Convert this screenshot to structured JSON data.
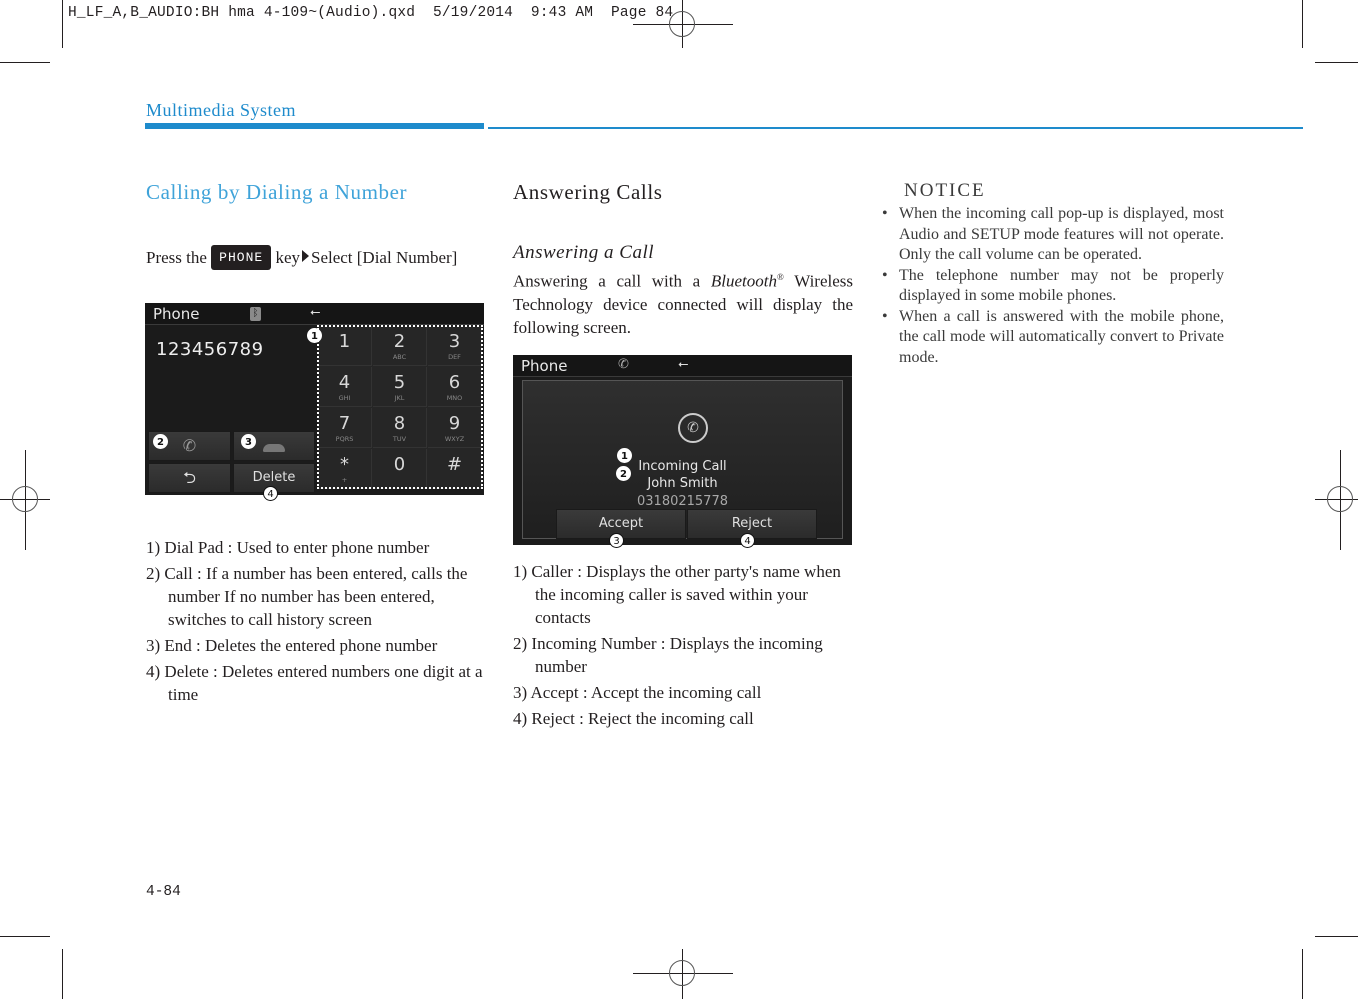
{
  "slug": "H_LF_A,B_AUDIO:BH hma 4-109~(Audio).qxd  5/19/2014  9:43 AM  Page 84",
  "header": {
    "section_title": "Multimedia System"
  },
  "colors": {
    "accent": "#1e8bcc",
    "heading_blue": "#3fa3d9",
    "text": "#231f20"
  },
  "column1": {
    "heading": "Calling by Dialing a Number",
    "instruction": {
      "prefix": "Press the",
      "key_label": "PHONE",
      "middle": "key",
      "suffix": "Select [Dial Number]"
    },
    "screen": {
      "title": "Phone",
      "status_icons": [
        "bluetooth-icon",
        "usb-icon"
      ],
      "entered_number": "123456789",
      "keys": [
        {
          "digit": "1",
          "letters": ""
        },
        {
          "digit": "2",
          "letters": "ABC"
        },
        {
          "digit": "3",
          "letters": "DEF"
        },
        {
          "digit": "4",
          "letters": "GHI"
        },
        {
          "digit": "5",
          "letters": "JKL"
        },
        {
          "digit": "6",
          "letters": "MNO"
        },
        {
          "digit": "7",
          "letters": "PQRS"
        },
        {
          "digit": "8",
          "letters": "TUV"
        },
        {
          "digit": "9",
          "letters": "WXYZ"
        },
        {
          "digit": "*",
          "letters": "+"
        },
        {
          "digit": "0",
          "letters": ""
        },
        {
          "digit": "#",
          "letters": ""
        }
      ],
      "buttons": {
        "call_icon": "call-icon",
        "end_icon": "end-call-icon",
        "back_icon": "back-icon",
        "delete": "Delete"
      },
      "callouts": [
        "1",
        "2",
        "3",
        "4"
      ]
    },
    "items": [
      "1) Dial Pad : Used to enter phone number",
      "2) Call : If a number has been entered, calls the number If no number has been entered, switches to call history screen",
      "3) End : Deletes the entered phone number",
      "4) Delete : Deletes entered numbers one digit at a time"
    ]
  },
  "column2": {
    "heading": "Answering Calls",
    "subheading": "Answering a Call",
    "intro_prefix": "Answering a call with a ",
    "intro_brand": "Bluetooth",
    "intro_reg": "®",
    "intro_suffix": " Wireless Technology device connected will display the following screen.",
    "screen": {
      "title": "Phone",
      "status_icons": [
        "call-icon",
        "usb-icon"
      ],
      "label": "Incoming Call",
      "caller": "John Smith",
      "number": "03180215778",
      "accept": "Accept",
      "reject": "Reject",
      "callouts": [
        "1",
        "2",
        "3",
        "4"
      ]
    },
    "items": [
      "1) Caller : Displays the other party's name when the incoming caller is saved within your contacts",
      "2) Incoming Number : Displays the incoming number",
      "3) Accept : Accept the incoming call",
      "4) Reject : Reject the incoming call"
    ]
  },
  "column3": {
    "notice_heading": "NOTICE",
    "bullets": [
      "When the incoming call pop-up is displayed, most Audio and SETUP mode features will not operate. Only the call volume can be operated.",
      "The telephone number may not be properly displayed in some mobile phones.",
      "When a call is answered with the mobile phone, the call mode will automatically convert to Private mode."
    ]
  },
  "footer": {
    "page_number": "4-84"
  }
}
